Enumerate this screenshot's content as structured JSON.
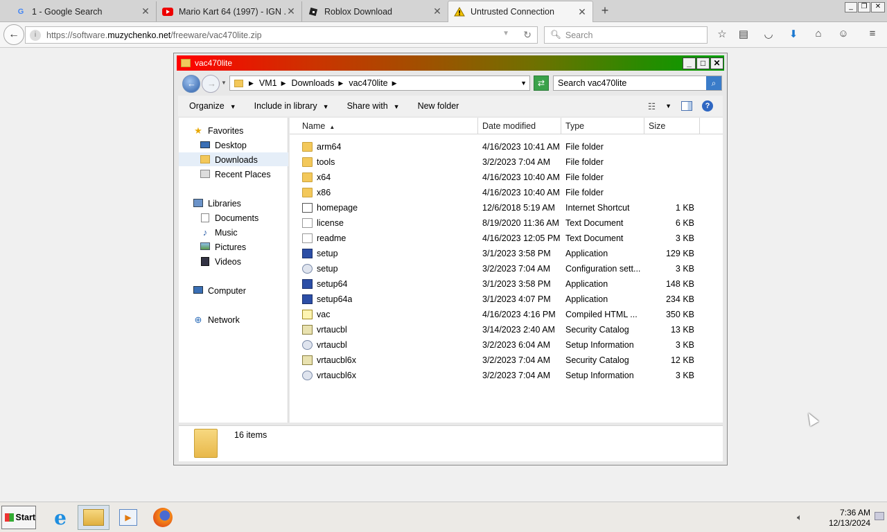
{
  "browser": {
    "tabs": [
      {
        "title": "1 - Google Search",
        "icon": "google-icon"
      },
      {
        "title": "Mario Kart 64 (1997) - IGN ...",
        "icon": "youtube-icon"
      },
      {
        "title": "Roblox Download",
        "icon": "roblox-icon"
      },
      {
        "title": "Untrusted Connection",
        "icon": "warning-icon"
      }
    ],
    "url_prefix": "https://software.",
    "url_domain": "muzychenko.net",
    "url_path": "/freeware/vac470lite.zip",
    "search_placeholder": "Search"
  },
  "explorer": {
    "title": "vac470lite",
    "breadcrumb": [
      "VM1",
      "Downloads",
      "vac470lite"
    ],
    "search_placeholder": "Search vac470lite",
    "commands": [
      "Organize",
      "Include in library",
      "Share with",
      "New folder"
    ],
    "nav": {
      "favorites": "Favorites",
      "desktop": "Desktop",
      "downloads": "Downloads",
      "recent": "Recent Places",
      "libraries": "Libraries",
      "documents": "Documents",
      "music": "Music",
      "pictures": "Pictures",
      "videos": "Videos",
      "computer": "Computer",
      "network": "Network"
    },
    "columns": {
      "name": "Name",
      "date": "Date modified",
      "type": "Type",
      "size": "Size"
    },
    "files": [
      {
        "name": "arm64",
        "date": "4/16/2023 10:41 AM",
        "type": "File folder",
        "size": "",
        "icon": "folder"
      },
      {
        "name": "tools",
        "date": "3/2/2023 7:04 AM",
        "type": "File folder",
        "size": "",
        "icon": "folder"
      },
      {
        "name": "x64",
        "date": "4/16/2023 10:40 AM",
        "type": "File folder",
        "size": "",
        "icon": "folder"
      },
      {
        "name": "x86",
        "date": "4/16/2023 10:40 AM",
        "type": "File folder",
        "size": "",
        "icon": "folder"
      },
      {
        "name": "homepage",
        "date": "12/6/2018 5:19 AM",
        "type": "Internet Shortcut",
        "size": "1 KB",
        "icon": "url"
      },
      {
        "name": "license",
        "date": "8/19/2020 11:36 AM",
        "type": "Text Document",
        "size": "6 KB",
        "icon": "doc"
      },
      {
        "name": "readme",
        "date": "4/16/2023 12:05 PM",
        "type": "Text Document",
        "size": "3 KB",
        "icon": "doc"
      },
      {
        "name": "setup",
        "date": "3/1/2023 3:58 PM",
        "type": "Application",
        "size": "129 KB",
        "icon": "app"
      },
      {
        "name": "setup",
        "date": "3/2/2023 7:04 AM",
        "type": "Configuration sett...",
        "size": "3 KB",
        "icon": "cfg"
      },
      {
        "name": "setup64",
        "date": "3/1/2023 3:58 PM",
        "type": "Application",
        "size": "148 KB",
        "icon": "app"
      },
      {
        "name": "setup64a",
        "date": "3/1/2023 4:07 PM",
        "type": "Application",
        "size": "234 KB",
        "icon": "app"
      },
      {
        "name": "vac",
        "date": "4/16/2023 4:16 PM",
        "type": "Compiled HTML ...",
        "size": "350 KB",
        "icon": "chm"
      },
      {
        "name": "vrtaucbl",
        "date": "3/14/2023 2:40 AM",
        "type": "Security Catalog",
        "size": "13 KB",
        "icon": "cat"
      },
      {
        "name": "vrtaucbl",
        "date": "3/2/2023 6:04 AM",
        "type": "Setup Information",
        "size": "3 KB",
        "icon": "cfg"
      },
      {
        "name": "vrtaucbl6x",
        "date": "3/2/2023 7:04 AM",
        "type": "Security Catalog",
        "size": "12 KB",
        "icon": "cat"
      },
      {
        "name": "vrtaucbl6x",
        "date": "3/2/2023 7:04 AM",
        "type": "Setup Information",
        "size": "3 KB",
        "icon": "cfg"
      }
    ],
    "item_count": "16 items"
  },
  "taskbar": {
    "start_label": "Start",
    "time": "7:36 AM",
    "date": "12/13/2024"
  }
}
